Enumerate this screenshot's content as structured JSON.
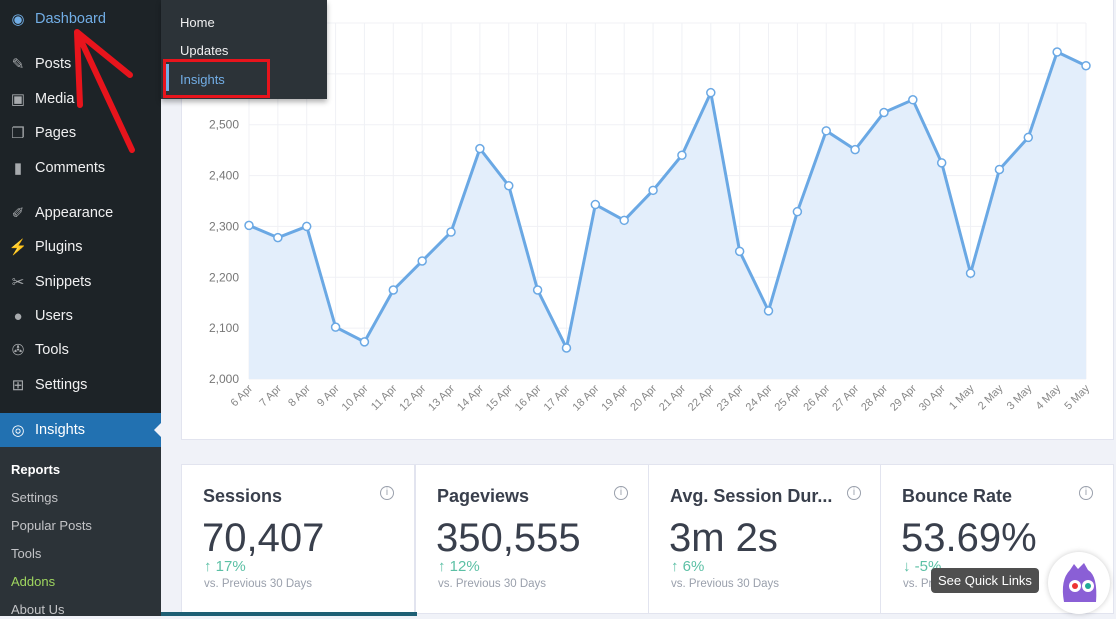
{
  "sidebar": {
    "items": [
      {
        "label": "Dashboard",
        "icon": "dashboard-icon"
      },
      {
        "label": "Posts",
        "icon": "pin-icon"
      },
      {
        "label": "Media",
        "icon": "media-icon"
      },
      {
        "label": "Pages",
        "icon": "pages-icon"
      },
      {
        "label": "Comments",
        "icon": "comment-icon"
      },
      {
        "label": "Appearance",
        "icon": "brush-icon"
      },
      {
        "label": "Plugins",
        "icon": "plugin-icon"
      },
      {
        "label": "Snippets",
        "icon": "scissors-icon"
      },
      {
        "label": "Users",
        "icon": "user-icon"
      },
      {
        "label": "Tools",
        "icon": "wrench-icon"
      },
      {
        "label": "Settings",
        "icon": "settings-icon"
      },
      {
        "label": "Insights",
        "icon": "insights-icon"
      }
    ],
    "submenu": [
      "Reports",
      "Settings",
      "Popular Posts",
      "Tools",
      "Addons",
      "About Us"
    ]
  },
  "flyout": {
    "items": [
      "Home",
      "Updates",
      "Insights"
    ]
  },
  "colors": {
    "accent": "#2271b1",
    "line": "#6aa8e4",
    "fill": "#e3eefb",
    "annotation": "#e8141c"
  },
  "chart_data": {
    "type": "area",
    "ylim": [
      2000,
      2700
    ],
    "yticks": [
      "2,000",
      "2,100",
      "2,200",
      "2,300",
      "2,400",
      "2,500"
    ],
    "grid": true,
    "categories": [
      "6 Apr",
      "7 Apr",
      "8 Apr",
      "9 Apr",
      "10 Apr",
      "11 Apr",
      "12 Apr",
      "13 Apr",
      "14 Apr",
      "15 Apr",
      "16 Apr",
      "17 Apr",
      "18 Apr",
      "19 Apr",
      "20 Apr",
      "21 Apr",
      "22 Apr",
      "23 Apr",
      "24 Apr",
      "25 Apr",
      "26 Apr",
      "27 Apr",
      "28 Apr",
      "29 Apr",
      "30 Apr",
      "1 May",
      "2 May",
      "3 May",
      "4 May",
      "5 May"
    ],
    "values": [
      2302,
      2278,
      2300,
      2102,
      2073,
      2175,
      2232,
      2289,
      2453,
      2380,
      2175,
      2061,
      2343,
      2312,
      2371,
      2440,
      2563,
      2251,
      2134,
      2329,
      2488,
      2451,
      2524,
      2549,
      2425,
      2208,
      2412,
      2475,
      2643,
      2616
    ]
  },
  "stats": [
    {
      "title": "Sessions",
      "value": "70,407",
      "change": "17%",
      "dir": "up",
      "prev": "vs. Previous 30 Days"
    },
    {
      "title": "Pageviews",
      "value": "350,555",
      "change": "12%",
      "dir": "up",
      "prev": "vs. Previous 30 Days"
    },
    {
      "title": "Avg. Session Dur...",
      "value": "3m 2s",
      "change": "6%",
      "dir": "up",
      "prev": "vs. Previous 30 Days"
    },
    {
      "title": "Bounce Rate",
      "value": "53.69%",
      "change": "-5%",
      "dir": "down",
      "prev": "vs. Previous 30 Days"
    }
  ],
  "tooltip": "See Quick Links",
  "info_glyph": "i"
}
